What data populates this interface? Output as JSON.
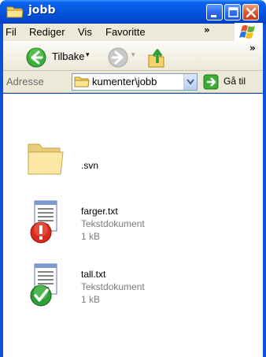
{
  "window": {
    "title": "jobb"
  },
  "menu": {
    "items": [
      "Fil",
      "Rediger",
      "Vis",
      "Favoritte"
    ],
    "more": "»"
  },
  "toolbar": {
    "back_label": "Tilbake",
    "back_dropdown": "▾",
    "forward_dropdown": "▾",
    "more": "»"
  },
  "address": {
    "label": "Adresse",
    "value": "kumenter\\jobb",
    "go_label": "Gå til"
  },
  "files": [
    {
      "name": ".svn",
      "icon": "folder-icon"
    },
    {
      "name": "farger.txt",
      "type": "Tekstdokument",
      "size": "1 kB",
      "icon": "text-file-conflict-icon",
      "status": "conflict"
    },
    {
      "name": "tall.txt",
      "type": "Tekstdokument",
      "size": "1 kB",
      "icon": "text-file-normal-icon",
      "status": "normal"
    }
  ],
  "colors": {
    "titlebar": "#0558e0",
    "chrome": "#ece9d8",
    "conflict": "#d62b1e",
    "normal": "#2f9e36"
  }
}
